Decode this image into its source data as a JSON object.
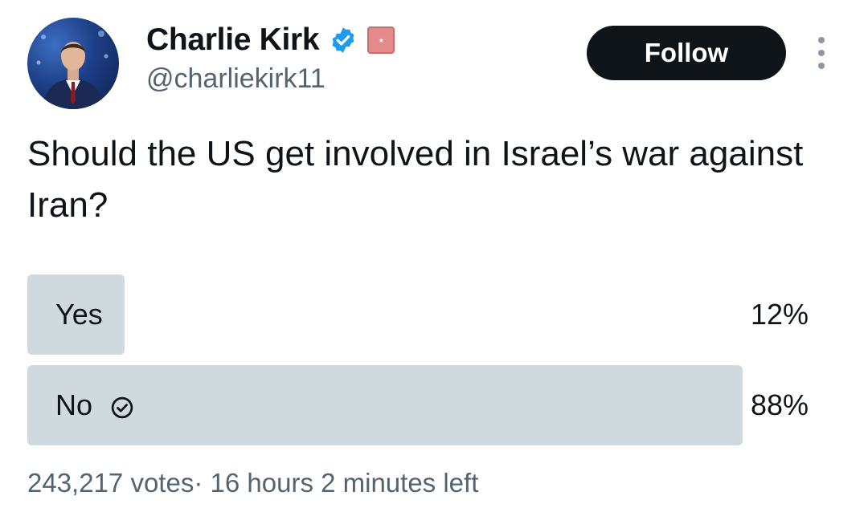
{
  "author": {
    "display_name": "Charlie Kirk",
    "handle": "@charliekirk11",
    "verified_icon": "verified-badge-icon",
    "verified_color": "#1d9bf0",
    "affiliate_badge_icon": "affiliate-badge-icon"
  },
  "follow_button": {
    "label": "Follow"
  },
  "menu": {
    "icon": "more-options-icon"
  },
  "tweet": {
    "text": "Should the US get involved in Israel’s war against Iran?"
  },
  "poll": {
    "options": [
      {
        "label": "Yes",
        "percent_label": "12%",
        "fraction": 0.12,
        "winner": false
      },
      {
        "label": "No",
        "percent_label": "88%",
        "fraction": 0.88,
        "winner": true
      }
    ],
    "votes": "243,217 votes",
    "separator": "·",
    "time_left": "16 hours 2 minutes left"
  },
  "colors": {
    "text": "#0f1419",
    "secondary": "#536471",
    "poll_fill": "#cfd9de",
    "button_bg": "#0f1419"
  }
}
